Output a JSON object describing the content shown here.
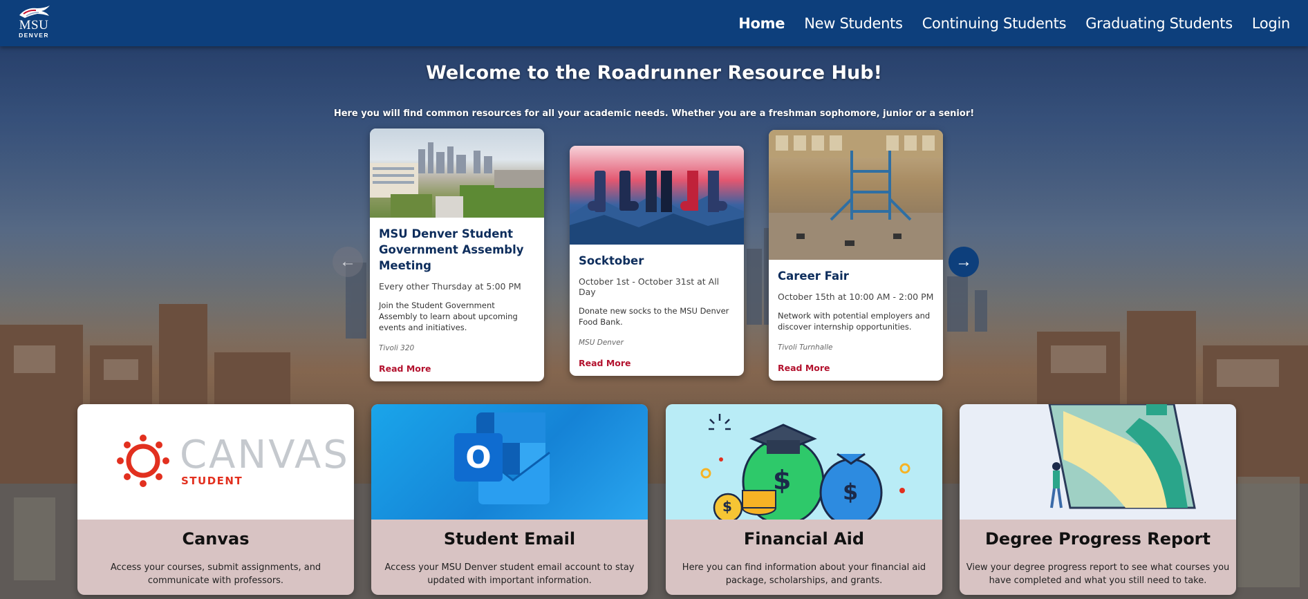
{
  "brand": {
    "line1": "MSU",
    "line2": "DENVER"
  },
  "nav": {
    "items": [
      {
        "label": "Home",
        "active": true
      },
      {
        "label": "New Students",
        "active": false
      },
      {
        "label": "Continuing Students",
        "active": false
      },
      {
        "label": "Graduating Students",
        "active": false
      },
      {
        "label": "Login",
        "active": false
      }
    ]
  },
  "hero": {
    "title": "Welcome to the Roadrunner Resource Hub!",
    "subtitle": "Here you will find common resources for all your academic needs. Whether you are a freshman sophomore, junior or a senior!"
  },
  "carousel": {
    "prev_icon": "arrow-left-icon",
    "next_icon": "arrow-right-icon",
    "prev_glyph": "←",
    "next_glyph": "→",
    "events": [
      {
        "title": "MSU Denver Student Government Assembly Meeting",
        "when": "Every other Thursday at 5:00 PM",
        "desc": "Join the Student Government Assembly to learn about upcoming events and initiatives.",
        "location": "Tivoli 320",
        "link": "Read More"
      },
      {
        "title": "Socktober",
        "when": "October 1st - October 31st at All Day",
        "desc": "Donate new socks to the MSU Denver Food Bank.",
        "location": "MSU Denver",
        "link": "Read More"
      },
      {
        "title": "Career Fair",
        "when": "October 15th at 10:00 AM - 2:00 PM",
        "desc": "Network with potential employers and discover internship opportunities.",
        "location": "Tivoli Turnhalle",
        "link": "Read More"
      }
    ]
  },
  "resources": [
    {
      "title": "Canvas",
      "desc": "Access your courses, submit assignments, and communicate with professors.",
      "logo_word": "CANVAS",
      "logo_sub": "STUDENT"
    },
    {
      "title": "Student Email",
      "desc": "Access your MSU Denver student email account to stay updated with important information.",
      "logo_letter": "O"
    },
    {
      "title": "Financial Aid",
      "desc": "Here you can find information about your financial aid package, scholarships, and grants.",
      "symbol": "$"
    },
    {
      "title": "Degree Progress Report",
      "desc": "View your degree progress report to see what courses you have completed and what you still need to take."
    }
  ],
  "colors": {
    "header": "#0d3f7c",
    "accent_red": "#b3122e",
    "card_title": "#0d2d5c",
    "resource_footer": "#d8c3c3"
  }
}
